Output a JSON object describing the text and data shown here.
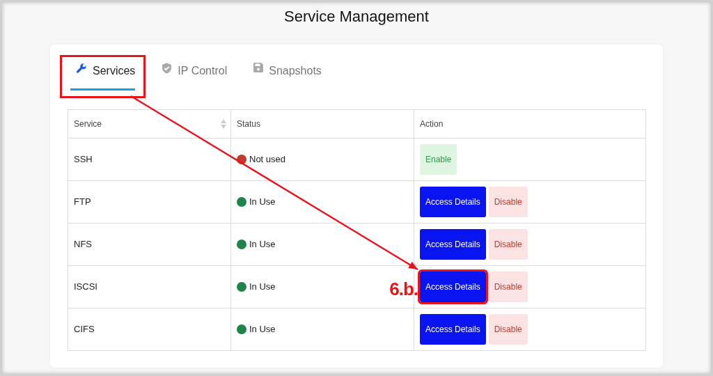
{
  "title": "Service Management",
  "tabs": [
    {
      "label": "Services",
      "selected": true,
      "highlighted": true
    },
    {
      "label": "IP Control",
      "selected": false,
      "highlighted": false
    },
    {
      "label": "Snapshots",
      "selected": false,
      "highlighted": false
    }
  ],
  "table": {
    "columns": [
      {
        "label": "Service",
        "sortable": true
      },
      {
        "label": "Status",
        "sortable": false
      },
      {
        "label": "Action",
        "sortable": false
      }
    ],
    "rows": [
      {
        "service": "SSH",
        "status": "Not used",
        "color": "#c0392b",
        "actions": [
          {
            "kind": "enable",
            "label": "Enable"
          }
        ],
        "highlighted": false
      },
      {
        "service": "FTP",
        "status": "In Use",
        "color": "#1e8449",
        "actions": [
          {
            "kind": "access",
            "label": "Access Details"
          },
          {
            "kind": "disable",
            "label": "Disable"
          }
        ],
        "highlighted": false
      },
      {
        "service": "NFS",
        "status": "In Use",
        "color": "#1e8449",
        "actions": [
          {
            "kind": "access",
            "label": "Access Details"
          },
          {
            "kind": "disable",
            "label": "Disable"
          }
        ],
        "highlighted": false
      },
      {
        "service": "ISCSI",
        "status": "In Use",
        "color": "#1e8449",
        "actions": [
          {
            "kind": "access",
            "label": "Access Details"
          },
          {
            "kind": "disable",
            "label": "Disable"
          }
        ],
        "highlighted": true,
        "callout": "6.b."
      },
      {
        "service": "CIFS",
        "status": "In Use",
        "color": "#1e8449",
        "actions": [
          {
            "kind": "access",
            "label": "Access Details"
          },
          {
            "kind": "disable",
            "label": "Disable"
          }
        ],
        "highlighted": false
      }
    ]
  }
}
